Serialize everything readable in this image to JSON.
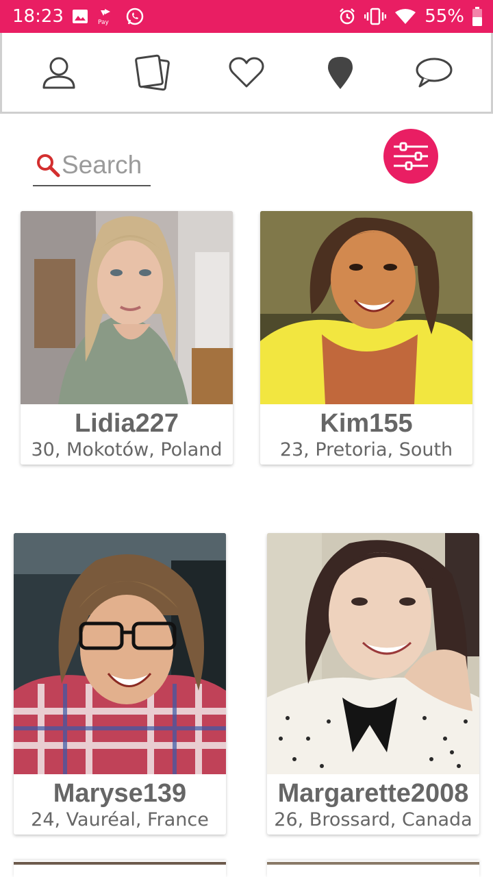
{
  "status_bar": {
    "time": "18:23",
    "battery_percent": "55%",
    "background_color": "#e91e63",
    "left_icons": [
      "image-icon",
      "pay-icon",
      "whatsapp-icon"
    ],
    "right_icons": [
      "alarm-icon",
      "vibrate-icon",
      "wifi-icon",
      "battery-icon"
    ]
  },
  "nav": {
    "items": [
      {
        "icon": "profile-icon"
      },
      {
        "icon": "cards-icon"
      },
      {
        "icon": "heart-icon"
      },
      {
        "icon": "location-pin-icon"
      },
      {
        "icon": "chat-icon"
      }
    ]
  },
  "search": {
    "placeholder": "Search",
    "value": ""
  },
  "filter": {
    "icon": "sliders-icon",
    "color": "#e91e63"
  },
  "profiles": [
    {
      "name": "Lidia227",
      "location": "30, Mokotów, Poland"
    },
    {
      "name": "Kim155",
      "location": "23, Pretoria, South"
    },
    {
      "name": "Maryse139",
      "location": "24, Vauréal, France"
    },
    {
      "name": "Margarette2008",
      "location": "26, Brossard, Canada"
    }
  ]
}
